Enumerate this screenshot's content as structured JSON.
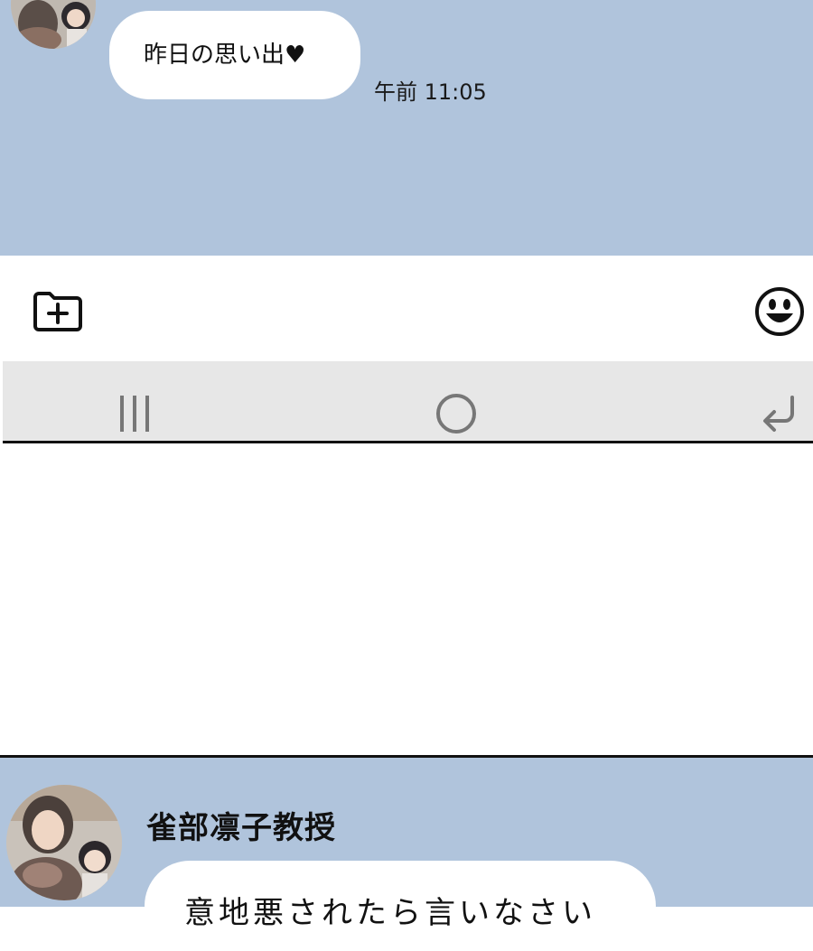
{
  "chat_top": {
    "message": "昨日の思い出♥",
    "time": "午前 11:05"
  },
  "input_bar": {
    "attach_icon": "folder-plus-icon",
    "emoji_icon": "smiley-icon"
  },
  "nav_bar": {
    "recents_icon": "recents-icon",
    "home_icon": "home-circle-icon",
    "back_icon": "back-arrow-icon"
  },
  "chat_bottom": {
    "sender_name": "雀部凛子教授",
    "message_partial": "意地悪されたら言いなさい"
  },
  "colors": {
    "chat_background": "#b0c4dc",
    "bubble": "#ffffff",
    "nav_bar": "#e7e7e7"
  }
}
